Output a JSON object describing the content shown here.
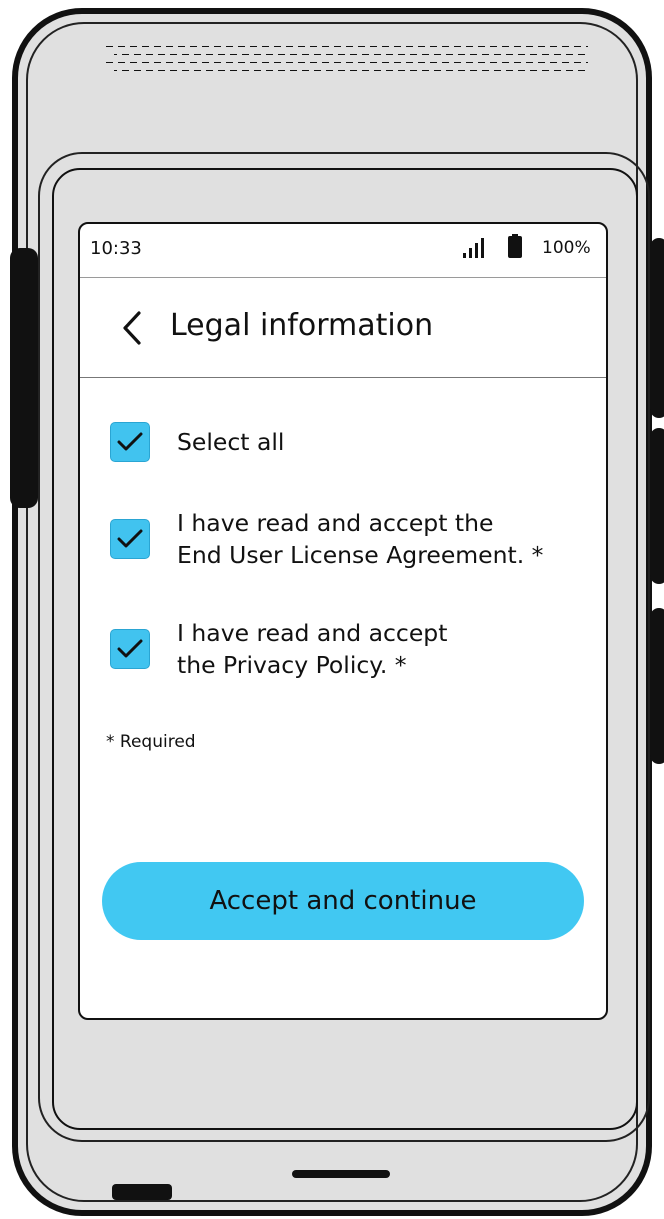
{
  "status_bar": {
    "time": "10:33",
    "battery_level": "100%",
    "signal_icon": "signal-bars-icon",
    "battery_icon": "battery-full-icon"
  },
  "header": {
    "back_icon": "chevron-left-icon",
    "title": "Legal information"
  },
  "consents": [
    {
      "label": "Select all",
      "checked": true
    },
    {
      "label_line1": "I have read and accept the",
      "label_line2": "End User License Agreement. *",
      "checked": true
    },
    {
      "label_line1": "I have read and accept",
      "label_line2": "the Privacy Policy. *",
      "checked": true
    }
  ],
  "required_note": "* Required",
  "accept_button": {
    "label": "Accept and continue"
  },
  "colors": {
    "accent": "#41c8f2",
    "device_gray": "#e0e0e0",
    "outline": "#111111"
  }
}
